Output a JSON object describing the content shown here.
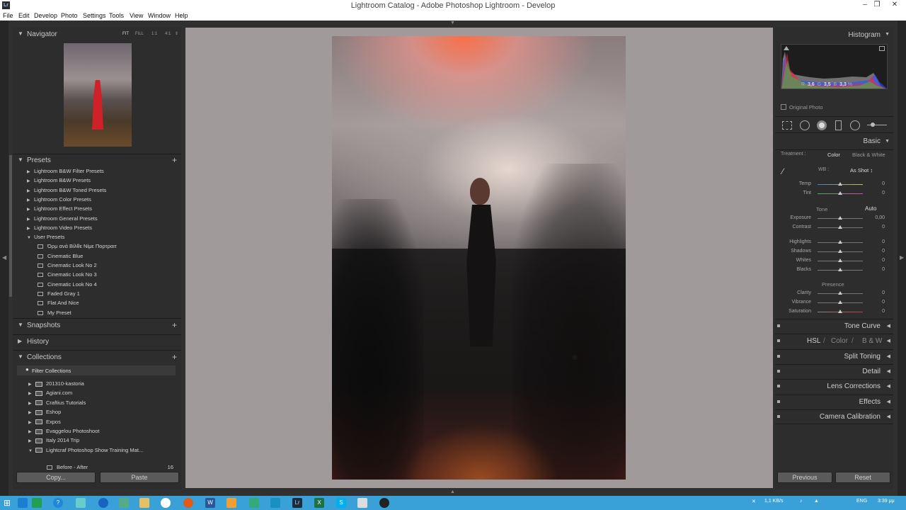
{
  "window": {
    "title": "Lightroom Catalog - Adobe Photoshop Lightroom - Develop",
    "app_icon": "Lr",
    "minimize": "–",
    "restore": "❐",
    "close": "✕"
  },
  "menu": [
    "File",
    "Edit",
    "Develop",
    "Photo",
    "Settings",
    "Tools",
    "View",
    "Window",
    "Help"
  ],
  "navigator": {
    "title": "Navigator",
    "zoom_options": [
      "FIT",
      "FILL",
      "1:1",
      "4:1"
    ]
  },
  "presets": {
    "title": "Presets",
    "groups": [
      "Lightroom B&W Filter Presets",
      "Lightroom B&W Presets",
      "Lightroom B&W Toned Presets",
      "Lightroom Color Presets",
      "Lightroom Effect Presets",
      "Lightroom General Presets",
      "Lightroom Video Presets",
      "User Presets"
    ],
    "user_presets": [
      "Όρμ ανά Βίλθε Νίμε Πορτραιτ",
      "Cinematic Blue",
      "Cinematic Look No 2",
      "Cinematic Look No 3",
      "Cinematic Look No 4",
      "Faded Gray 1",
      "Flat And Nice",
      "My Preset"
    ]
  },
  "snapshots": {
    "title": "Snapshots"
  },
  "history": {
    "title": "History"
  },
  "collections": {
    "title": "Collections",
    "filter": "Filter Collections",
    "items": [
      "201310-kastoria",
      "Agiani.com",
      "Craftius Tutorials",
      "Eshop",
      "Expos",
      "Evaggelou Photoshoot",
      "Italy 2014 Trip",
      "Lightcraf Photoshop Show Training Mat..."
    ],
    "sub_item": {
      "label": "Before - After",
      "count": "16"
    }
  },
  "left_buttons": {
    "copy": "Copy...",
    "paste": "Paste"
  },
  "histogram": {
    "title": "Histogram",
    "r_label": "R",
    "r_value": "3,6",
    "g_label": "G",
    "g_value": "3,5",
    "b_label": "B",
    "b_value": "3,3",
    "percent": "%",
    "original_photo": "Original Photo"
  },
  "basic": {
    "title": "Basic",
    "treatment_label": "Treatment :",
    "color": "Color",
    "bw": "Black & White",
    "wb_label": "WB :",
    "wb_value": "As Shot ↕",
    "tone_label": "Tone",
    "auto": "Auto",
    "presence_label": "Presence",
    "sliders": [
      {
        "name": "Temp",
        "value": "0",
        "pos": 0.5
      },
      {
        "name": "Tint",
        "value": "0",
        "pos": 0.5
      },
      {
        "name": "Exposure",
        "value": "0,00",
        "pos": 0.5
      },
      {
        "name": "Contrast",
        "value": "0",
        "pos": 0.5
      },
      {
        "name": "Highlights",
        "value": "0",
        "pos": 0.5
      },
      {
        "name": "Shadows",
        "value": "0",
        "pos": 0.5
      },
      {
        "name": "Whites",
        "value": "0",
        "pos": 0.5
      },
      {
        "name": "Blacks",
        "value": "0",
        "pos": 0.5
      },
      {
        "name": "Clarity",
        "value": "0",
        "pos": 0.5
      },
      {
        "name": "Vibrance",
        "value": "0",
        "pos": 0.5
      },
      {
        "name": "Saturation",
        "value": "0",
        "pos": 0.5
      }
    ]
  },
  "sections": {
    "tone_curve": "Tone Curve",
    "hsl": "HSL",
    "slash": "/",
    "color": "Color",
    "bw": "B & W",
    "split_toning": "Split Toning",
    "detail": "Detail",
    "lens_corrections": "Lens Corrections",
    "effects": "Effects",
    "camera_calibration": "Camera Calibration"
  },
  "right_buttons": {
    "previous": "Previous",
    "reset": "Reset"
  },
  "tray": {
    "lang": "ENG",
    "time": "3:39 μμ",
    "net": "1,1 KB/s"
  },
  "colors": {
    "panel": "#2d2d2d",
    "canvas": "#a19a9b",
    "taskbar": "#3aa0d8"
  }
}
